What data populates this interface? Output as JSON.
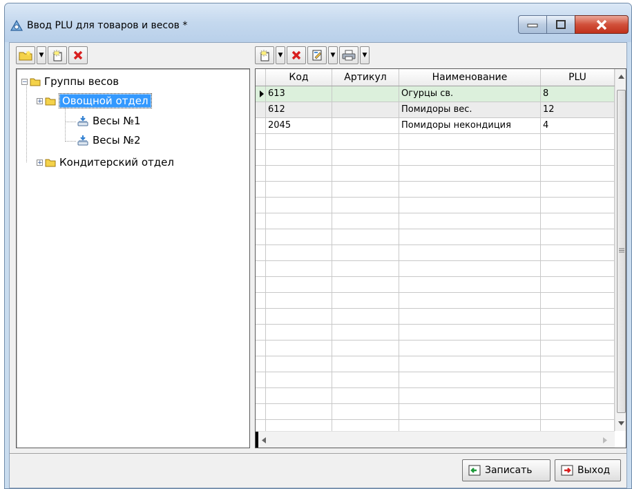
{
  "window": {
    "title": "Ввод PLU для товаров и весов *"
  },
  "tree": {
    "root": "Группы весов",
    "groups": [
      {
        "label": "Овощной отдел",
        "children": [
          "Весы №1",
          "Весы №2"
        ]
      },
      {
        "label": "Кондитерский отдел"
      }
    ]
  },
  "grid": {
    "columns": [
      "Код",
      "Артикул",
      "Наименование",
      "PLU"
    ],
    "rows": [
      {
        "code": "613",
        "article": "",
        "name": "Огурцы св.",
        "plu": "8"
      },
      {
        "code": "612",
        "article": "",
        "name": "Помидоры вес.",
        "plu": "12"
      },
      {
        "code": "2045",
        "article": "",
        "name": "Помидоры некондиция",
        "plu": "4"
      }
    ]
  },
  "buttons": {
    "save": "Записать",
    "exit": "Выход"
  },
  "icons": {
    "add_folder": "new-folder-icon",
    "add": "add-record-icon",
    "delete": "delete-icon",
    "edit": "edit-icon",
    "print": "printer-icon",
    "dropdown": "dropdown-arrow-icon"
  },
  "colors": {
    "selection": "#3399ff",
    "active_row": "#dcf0dc",
    "delete_red": "#d81f1f",
    "close_button": "#c0311c"
  }
}
